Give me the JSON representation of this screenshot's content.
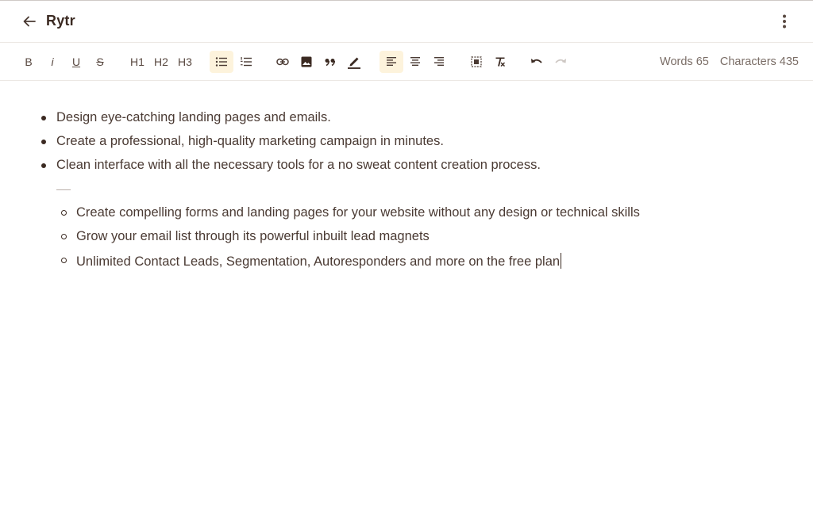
{
  "header": {
    "title": "Rytr"
  },
  "toolbar": {
    "bold": "B",
    "italic": "i",
    "underline": "U",
    "strike": "S",
    "h1": "H1",
    "h2": "H2",
    "h3": "H3",
    "words_label": "Words 65",
    "characters_label": "Characters 435"
  },
  "editor": {
    "bullets": [
      "Design eye-catching landing pages and emails.",
      "Create a professional, high-quality marketing campaign in minutes.",
      "Clean interface with all the necessary tools for a no sweat content creation process."
    ],
    "sub_bullets": [
      "Create compelling forms and landing pages for your website without any design or technical skills",
      "Grow your email list through its powerful inbuilt lead magnets",
      "Unlimited Contact Leads, Segmentation, Autoresponders and more on the free plan"
    ]
  },
  "colors": {
    "accent_bg": "#fdf3dc",
    "text": "#4a3a33",
    "title": "#3b2a22"
  },
  "icons": [
    "back-arrow-icon",
    "more-vertical-icon",
    "bullet-list-icon",
    "numbered-list-icon",
    "link-icon",
    "image-icon",
    "quote-icon",
    "highlight-pen-icon",
    "align-left-icon",
    "align-center-icon",
    "align-right-icon",
    "select-all-icon",
    "clear-format-icon",
    "undo-icon",
    "redo-icon"
  ]
}
